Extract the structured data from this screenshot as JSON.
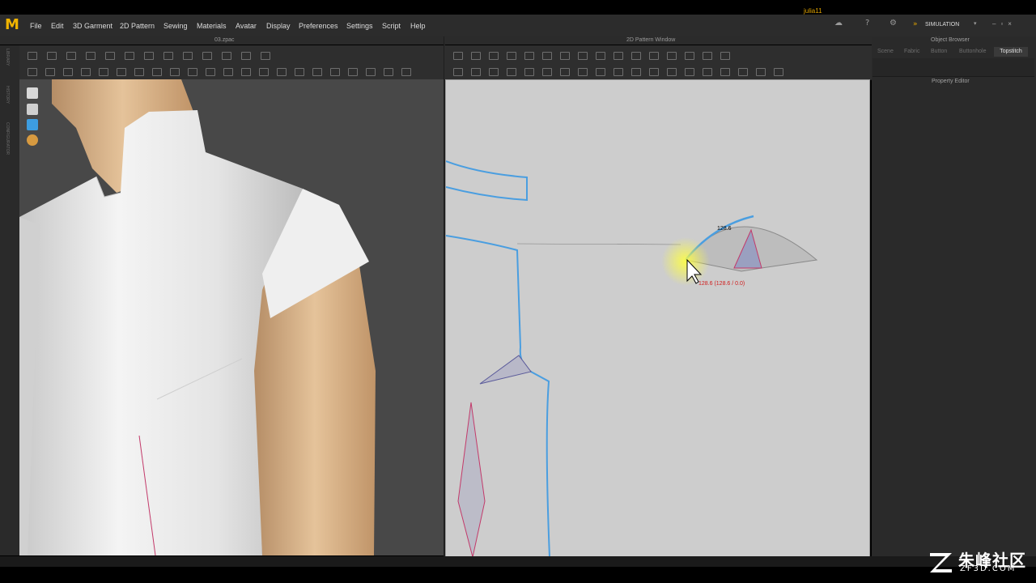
{
  "menu": [
    "File",
    "Edit",
    "3D Garment",
    "2D Pattern",
    "Sewing",
    "Materials",
    "Avatar",
    "Display",
    "Preferences",
    "Settings",
    "Script",
    "Help"
  ],
  "user": "julia11",
  "simulation_label": "SIMULATION",
  "panels": {
    "left_title": "03.zpac",
    "right_title": "2D Pattern Window",
    "object_browser": "Object Browser",
    "property_editor": "Property Editor"
  },
  "object_browser_tabs": [
    "Scene",
    "Fabric",
    "Button",
    "Buttonhole",
    "Topstitch"
  ],
  "left_strip_labels": [
    "LIBRARY",
    "HISTORY",
    "CONFIGURATOR"
  ],
  "measure": {
    "length_label": "128.6",
    "readout": "128.6 (128.6 / 0.0)"
  },
  "watermark": {
    "chinese": "朱峰社区",
    "url": "ZF3D.COM"
  },
  "colors": {
    "accent": "#f0b400",
    "pattern_line": "#4a9ee0",
    "dart_line": "#c33a6a",
    "highlight": "#ffff40"
  }
}
